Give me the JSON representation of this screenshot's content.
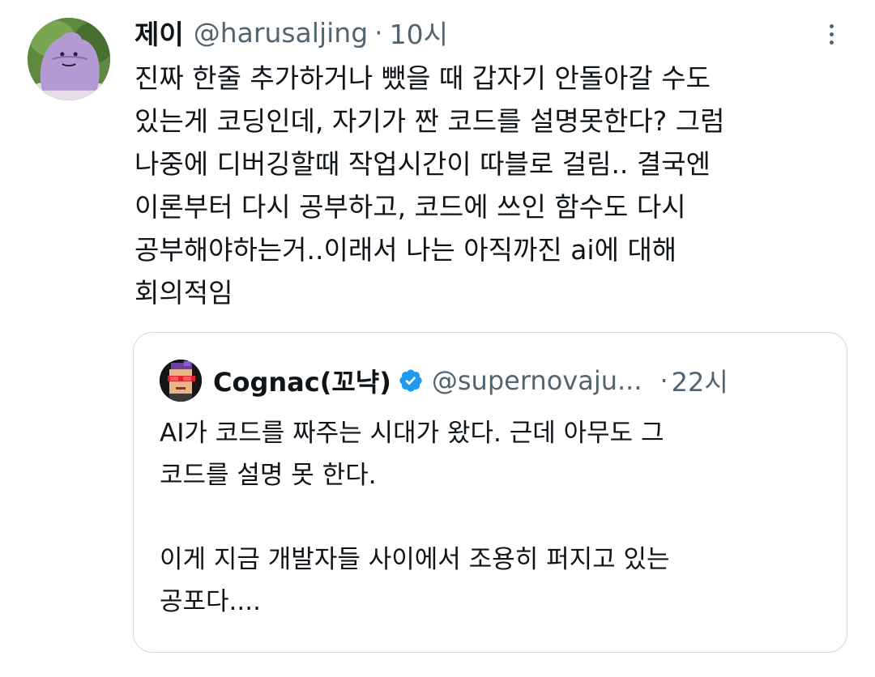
{
  "tweet": {
    "author": {
      "display_name": "제이",
      "handle": "@harusaljing",
      "separator": "·",
      "time": "10시",
      "avatar_icon": "ditto-avatar"
    },
    "more_icon": "more-dots-vertical-icon",
    "text_lines": [
      "진짜 한줄 추가하거나 뺐을 때 갑자기 안돌아갈 수도",
      "있는게 코딩인데, 자기가 짠 코드를 설명못한다? 그럼",
      "나중에 디버깅할때 작업시간이 따블로 걸림.. 결국엔",
      "이론부터 다시 공부하고, 코드에 쓰인 함수도 다시",
      "공부해야하는거..이래서 나는 아직까진 ai에 대해",
      "회의적임"
    ]
  },
  "quoted": {
    "author": {
      "display_name": "Cognac(꼬냑)",
      "verified_icon": "verified-badge-icon",
      "handle": "@supernovaju...",
      "separator": "·",
      "time": "22시",
      "avatar_icon": "pixel-art-avatar"
    },
    "text_lines": [
      "AI가 코드를 짜주는 시대가 왔다. 근데 아무도 그",
      "코드를 설명 못 한다."
    ],
    "text_lines_2": [
      "이게 지금 개발자들 사이에서 조용히 퍼지고 있는",
      "공포다...."
    ]
  },
  "colors": {
    "text": "#0f1419",
    "secondary": "#536471",
    "border": "#cfd9de",
    "verified": "#1d9bf0"
  }
}
